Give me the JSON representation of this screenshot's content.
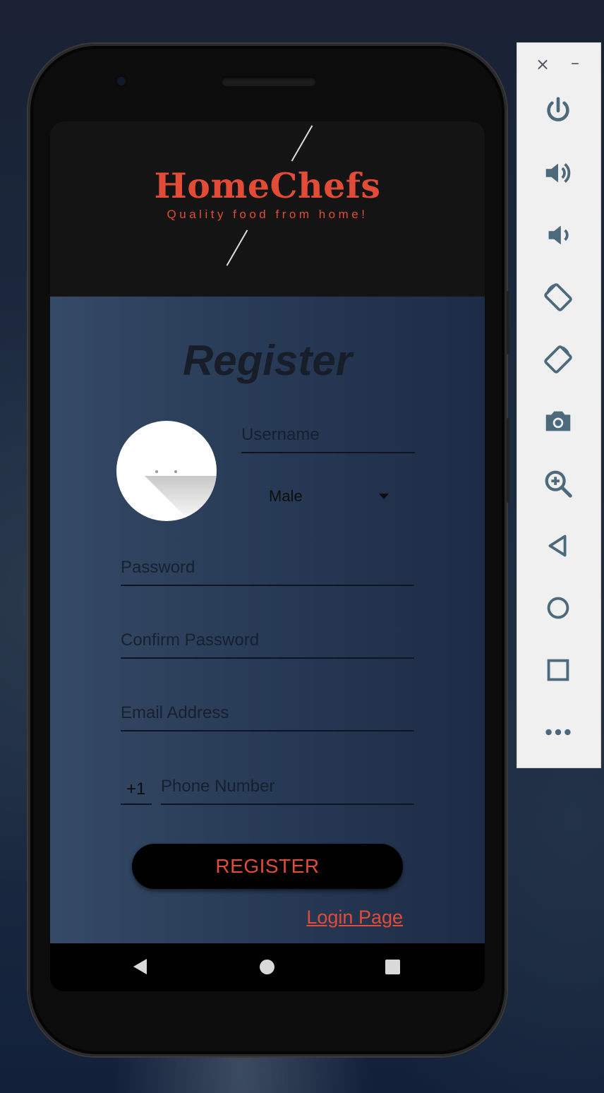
{
  "app": {
    "brand": "HomeChefs",
    "tagline": "Quality food from home!",
    "accent_color": "#e24b36"
  },
  "register": {
    "title": "Register",
    "username_placeholder": "Username",
    "gender_value": "Male",
    "password_placeholder": "Password",
    "confirm_password_placeholder": "Confirm Password",
    "email_placeholder": "Email Address",
    "country_code": "+1",
    "phone_placeholder": "Phone Number",
    "register_button": "REGISTER",
    "login_link": "Login Page"
  },
  "navigation_bar": {
    "icons": [
      "back-icon",
      "home-icon",
      "recents-icon"
    ]
  },
  "emulator_toolbar": {
    "close": "×",
    "minimize": "–",
    "buttons": [
      "power-icon",
      "volume-up-icon",
      "volume-down-icon",
      "rotate-left-icon",
      "rotate-right-icon",
      "camera-icon",
      "zoom-icon",
      "back-icon",
      "home-icon",
      "overview-icon",
      "more-icon"
    ]
  }
}
